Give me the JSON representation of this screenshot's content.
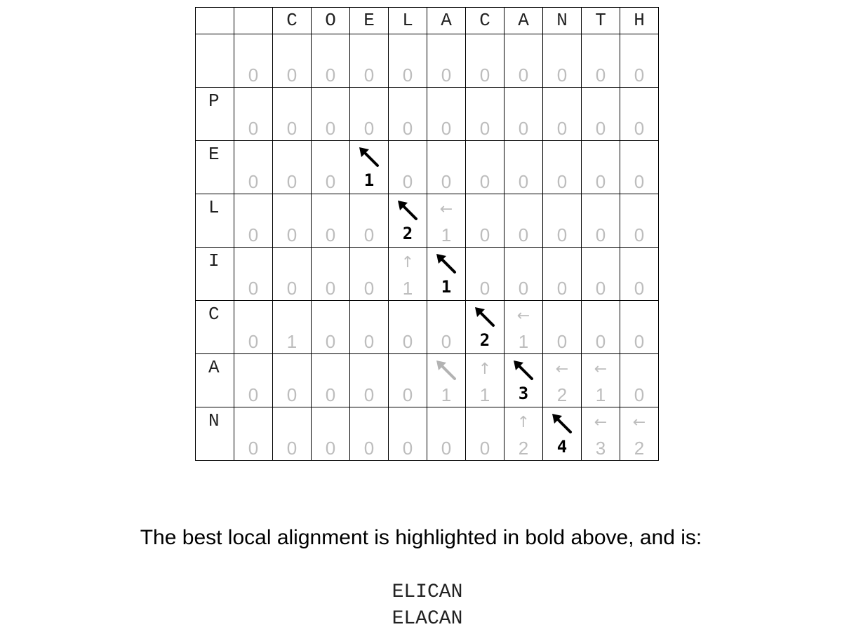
{
  "matrix": {
    "columns": [
      "C",
      "O",
      "E",
      "L",
      "A",
      "C",
      "A",
      "N",
      "T",
      "H"
    ],
    "rows": [
      "",
      "P",
      "E",
      "L",
      "I",
      "C",
      "A",
      "N"
    ],
    "scores": [
      [
        0,
        0,
        0,
        0,
        0,
        0,
        0,
        0,
        0,
        0,
        0
      ],
      [
        0,
        0,
        0,
        0,
        0,
        0,
        0,
        0,
        0,
        0,
        0
      ],
      [
        0,
        0,
        0,
        1,
        0,
        0,
        0,
        0,
        0,
        0,
        0
      ],
      [
        0,
        0,
        0,
        0,
        2,
        1,
        0,
        0,
        0,
        0,
        0
      ],
      [
        0,
        0,
        0,
        0,
        1,
        1,
        0,
        0,
        0,
        0,
        0
      ],
      [
        0,
        1,
        0,
        0,
        0,
        0,
        2,
        1,
        0,
        0,
        0
      ],
      [
        0,
        0,
        0,
        0,
        0,
        1,
        1,
        3,
        2,
        1,
        0
      ],
      [
        0,
        0,
        0,
        0,
        0,
        0,
        0,
        2,
        4,
        3,
        2
      ]
    ],
    "arrows": [
      [
        "",
        "",
        "",
        "",
        "",
        "",
        "",
        "",
        "",
        "",
        ""
      ],
      [
        "",
        "",
        "",
        "",
        "",
        "",
        "",
        "",
        "",
        "",
        ""
      ],
      [
        "",
        "",
        "",
        "diag",
        "",
        "",
        "",
        "",
        "",
        "",
        ""
      ],
      [
        "",
        "",
        "",
        "",
        "diag",
        "left",
        "",
        "",
        "",
        "",
        ""
      ],
      [
        "",
        "",
        "",
        "",
        "up",
        "diag",
        "",
        "",
        "",
        "",
        ""
      ],
      [
        "",
        "",
        "",
        "",
        "",
        "",
        "diag",
        "left",
        "",
        "",
        ""
      ],
      [
        "",
        "",
        "",
        "",
        "",
        "diag",
        "up",
        "diag",
        "left",
        "left",
        ""
      ],
      [
        "",
        "",
        "",
        "",
        "",
        "",
        "",
        "up",
        "diag",
        "left",
        "left"
      ]
    ],
    "highlighted": [
      [
        2,
        3
      ],
      [
        3,
        4
      ],
      [
        4,
        5
      ],
      [
        5,
        6
      ],
      [
        6,
        7
      ],
      [
        7,
        8
      ]
    ],
    "colors": {
      "highlight": "#000000",
      "faded_text": "#bdbdbd",
      "faded_diag_arrow": "#b3b3b3",
      "grid_line": "#000000"
    }
  },
  "caption": "The best local alignment is highlighted in bold above, and is:",
  "alignment": {
    "line1": "ELICAN",
    "line2": "ELACAN"
  }
}
